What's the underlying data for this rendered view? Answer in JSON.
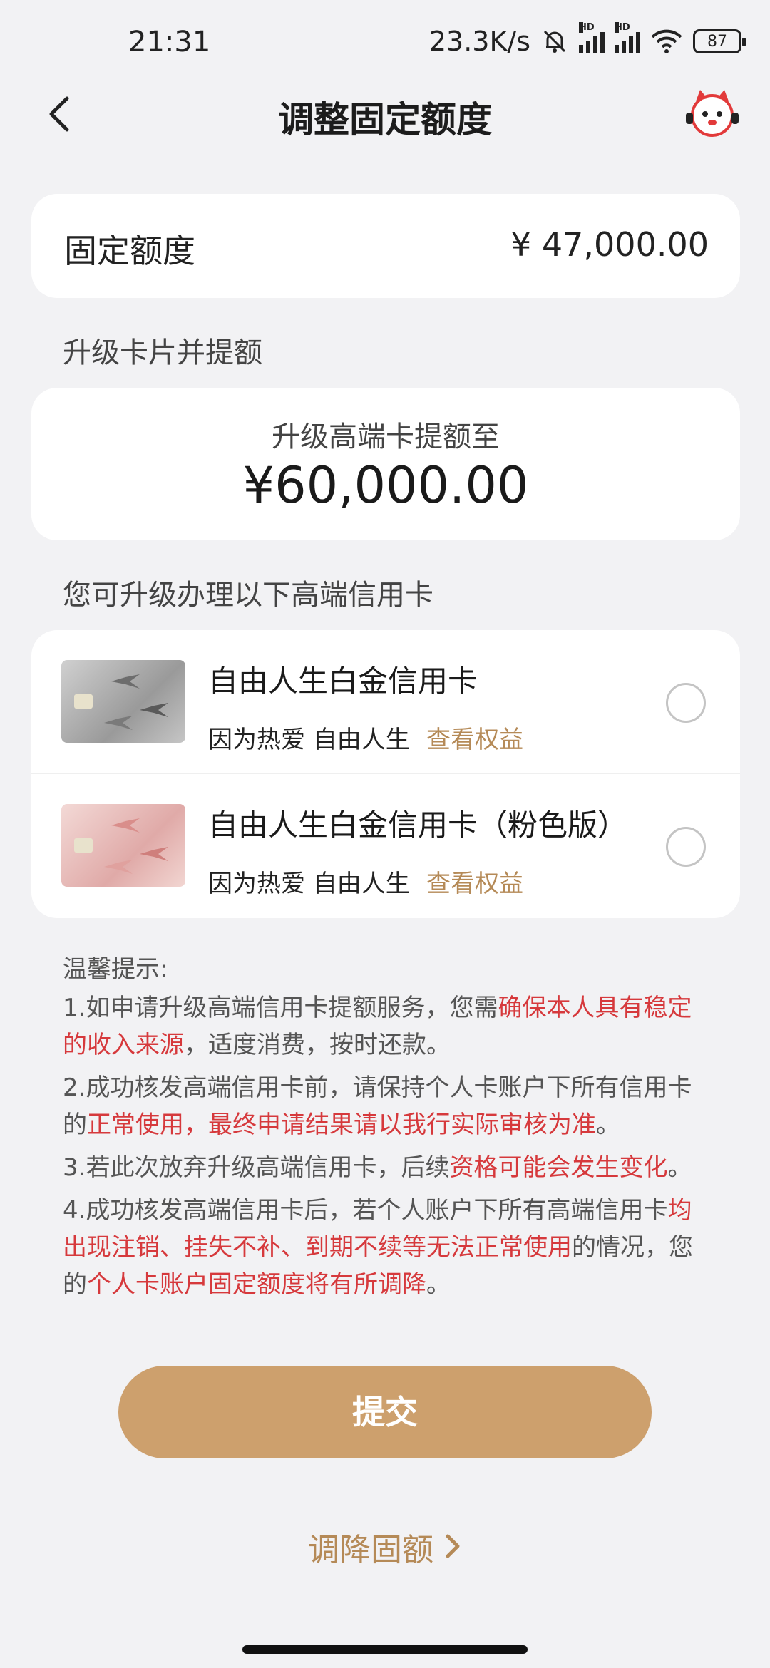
{
  "status_bar": {
    "time": "21:31",
    "net_speed": "23.3K/s",
    "signal_1_label": "HD",
    "signal_2_label": "HD",
    "battery": "87",
    "icons": [
      "mute-bell-icon",
      "signal-icon",
      "signal-icon",
      "wifi-icon",
      "battery-icon"
    ]
  },
  "header": {
    "title": "调整固定额度",
    "back_icon": "chevron-left-icon",
    "assistant_icon": "mascot-icon"
  },
  "fixed_limit": {
    "label": "固定额度",
    "value": "¥ 47,000.00"
  },
  "upgrade_section": {
    "label": "升级卡片并提额",
    "caption": "升级高端卡提额至",
    "amount": "¥60,000.00"
  },
  "options_section": {
    "label": "您可升级办理以下高端信用卡",
    "options": [
      {
        "title": "自由人生白金信用卡",
        "subtitle": "因为热爱 自由人生",
        "link": "查看权益",
        "selected": false
      },
      {
        "title": "自由人生白金信用卡（粉色版）",
        "subtitle": "因为热爱 自由人生",
        "link": "查看权益",
        "selected": false
      }
    ]
  },
  "tips": {
    "title": "温馨提示:",
    "items": [
      {
        "a": "1.如申请升级高端信用卡提额服务，您需",
        "b": "确保本人具有稳定的收入来源",
        "c": "，适度消费，按时还款。"
      },
      {
        "a": "2.成功核发高端信用卡前，请保持个人卡账户下所有信用卡的",
        "b": "正常使用，最终申请结果请以我行实际审核为准",
        "c": "。"
      },
      {
        "a": "3.若此次放弃升级高端信用卡，后续",
        "b": "资格可能会发生变化",
        "c": "。"
      },
      {
        "a": "4.成功核发高端信用卡后，若个人账户下所有高端信用卡",
        "b": "均出现注销、挂失不补、到期不续等无法正常使用",
        "c": "的情况，您的",
        "d": "个人卡账户固定额度将有所调降",
        "e": "。"
      }
    ],
    "highlight_color": "#d6393c"
  },
  "actions": {
    "submit_label": "提交",
    "lower_label": "调降固额",
    "accent_color": "#cda06d"
  }
}
